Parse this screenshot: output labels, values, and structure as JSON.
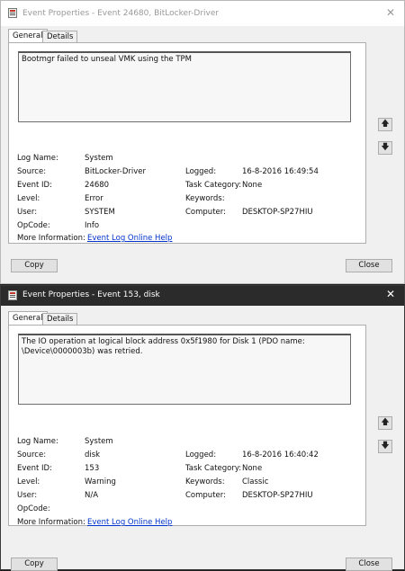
{
  "windows": [
    {
      "title": "Event Properties - Event 24680, BitLocker-Driver",
      "tabs": [
        "General",
        "Details"
      ],
      "message": "Bootmgr failed to unseal VMK using the TPM",
      "labels": {
        "log_name": "Log Name:",
        "source": "Source:",
        "event_id": "Event ID:",
        "level": "Level:",
        "user": "User:",
        "opcode": "OpCode:",
        "more_info": "More Information:",
        "logged": "Logged:",
        "task_category": "Task Category:",
        "keywords": "Keywords:",
        "computer": "Computer:"
      },
      "values": {
        "log_name": "System",
        "source": "BitLocker-Driver",
        "event_id": "24680",
        "level": "Error",
        "user": "SYSTEM",
        "opcode": "Info",
        "more_info_link": "Event Log Online Help",
        "logged": "16-8-2016 16:49:54",
        "task_category": "None",
        "keywords": "",
        "computer": "DESKTOP-SP27HIU"
      },
      "buttons": {
        "copy": "Copy",
        "close": "Close"
      }
    },
    {
      "title": "Event Properties - Event 153, disk",
      "tabs": [
        "General",
        "Details"
      ],
      "message": "The IO operation at logical block address 0x5f1980 for Disk 1 (PDO name: \\Device\\0000003b) was retried.",
      "labels": {
        "log_name": "Log Name:",
        "source": "Source:",
        "event_id": "Event ID:",
        "level": "Level:",
        "user": "User:",
        "opcode": "OpCode:",
        "more_info": "More Information:",
        "logged": "Logged:",
        "task_category": "Task Category:",
        "keywords": "Keywords:",
        "computer": "Computer:"
      },
      "values": {
        "log_name": "System",
        "source": "disk",
        "event_id": "153",
        "level": "Warning",
        "user": "N/A",
        "opcode": "",
        "more_info_link": "Event Log Online Help",
        "logged": "16-8-2016 16:40:42",
        "task_category": "None",
        "keywords": "Classic",
        "computer": "DESKTOP-SP27HIU"
      },
      "buttons": {
        "copy": "Copy",
        "close": "Close"
      }
    }
  ],
  "icons": {
    "up": "arrow-up-icon",
    "down": "arrow-down-icon",
    "app": "event-viewer-icon",
    "close": "close-icon"
  }
}
